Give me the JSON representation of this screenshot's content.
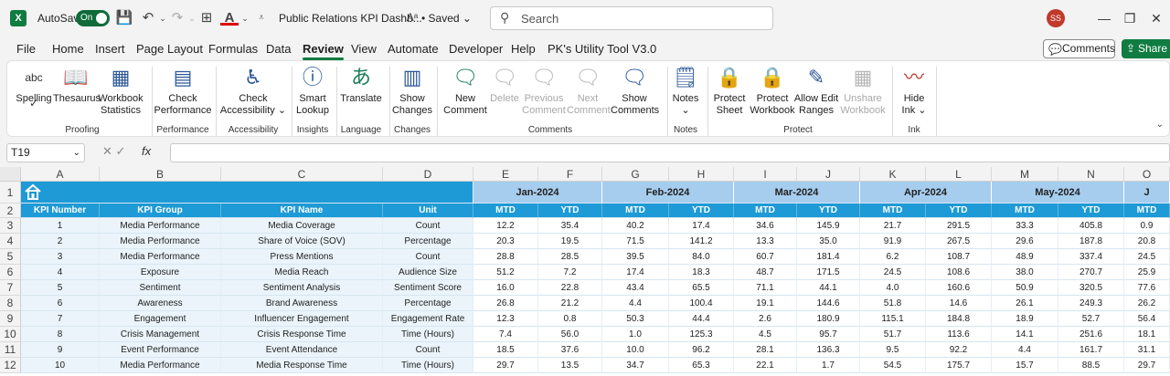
{
  "titlebar": {
    "autosave_label": "AutoSave",
    "autosave_state": "On",
    "doc_title": "Public Relations KPI Dashb...",
    "saved": "Saved",
    "search_placeholder": "Search",
    "avatar_initials": "SS"
  },
  "tabs": [
    "File",
    "Home",
    "Insert",
    "Page Layout",
    "Formulas",
    "Data",
    "Review",
    "View",
    "Automate",
    "Developer",
    "Help",
    "PK's Utility Tool V3.0"
  ],
  "active_tab": "Review",
  "comments_button": "Comments",
  "share_button": "Share",
  "ribbon": {
    "buttons": [
      {
        "label": "Spelling",
        "icon": "spelling-icon",
        "disabled": false
      },
      {
        "label": "Thesaurus",
        "icon": "thesaurus-icon",
        "disabled": false
      },
      {
        "label": "Workbook Statistics",
        "line1": "Workbook",
        "line2": "Statistics",
        "icon": "workbook-statistics-icon",
        "disabled": false
      },
      {
        "label": "Check Performance",
        "line1": "Check",
        "line2": "Performance",
        "icon": "check-performance-icon",
        "disabled": false
      },
      {
        "label": "Check Accessibility",
        "line1": "Check",
        "line2": "Accessibility ⌄",
        "icon": "accessibility-icon",
        "disabled": false
      },
      {
        "label": "Smart Lookup",
        "line1": "Smart",
        "line2": "Lookup",
        "icon": "smart-lookup-icon",
        "disabled": false
      },
      {
        "label": "Translate",
        "icon": "translate-icon",
        "disabled": false
      },
      {
        "label": "Show Changes",
        "line1": "Show",
        "line2": "Changes",
        "icon": "show-changes-icon",
        "disabled": false
      },
      {
        "label": "New Comment",
        "line1": "New",
        "line2": "Comment",
        "icon": "new-comment-icon",
        "disabled": false
      },
      {
        "label": "Delete",
        "icon": "delete-comment-icon",
        "disabled": true
      },
      {
        "label": "Previous Comment",
        "line1": "Previous",
        "line2": "Comment",
        "icon": "previous-comment-icon",
        "disabled": true
      },
      {
        "label": "Next Comment",
        "line1": "Next",
        "line2": "Comment",
        "icon": "next-comment-icon",
        "disabled": true
      },
      {
        "label": "Show Comments",
        "line1": "Show",
        "line2": "Comments",
        "icon": "show-comments-icon",
        "disabled": false
      },
      {
        "label": "Notes",
        "line1": "Notes",
        "line2": "⌄",
        "icon": "notes-icon",
        "disabled": false
      },
      {
        "label": "Protect Sheet",
        "line1": "Protect",
        "line2": "Sheet",
        "icon": "protect-sheet-icon",
        "disabled": false
      },
      {
        "label": "Protect Workbook",
        "line1": "Protect",
        "line2": "Workbook",
        "icon": "protect-workbook-icon",
        "disabled": false
      },
      {
        "label": "Allow Edit Ranges",
        "line1": "Allow Edit",
        "line2": "Ranges",
        "icon": "allow-edit-ranges-icon",
        "disabled": false
      },
      {
        "label": "Unshare Workbook",
        "line1": "Unshare",
        "line2": "Workbook",
        "icon": "unshare-workbook-icon",
        "disabled": true
      },
      {
        "label": "Hide Ink",
        "line1": "Hide",
        "line2": "Ink ⌄",
        "icon": "hide-ink-icon",
        "disabled": false
      }
    ],
    "groups": [
      "Proofing",
      "Performance",
      "Accessibility",
      "Insights",
      "Language",
      "Changes",
      "Comments",
      "Notes",
      "Protect",
      "Ink"
    ]
  },
  "formula_bar": {
    "name_box": "T19",
    "fx": "fx",
    "formula": ""
  },
  "sheet": {
    "column_letters": [
      "A",
      "B",
      "C",
      "D",
      "E",
      "F",
      "G",
      "H",
      "I",
      "J",
      "K",
      "L",
      "M",
      "N",
      "O"
    ],
    "row_numbers": [
      "1",
      "2",
      "3",
      "4",
      "5",
      "6",
      "7",
      "8",
      "9",
      "10",
      "11",
      "12"
    ],
    "months": [
      "Jan-2024",
      "Feb-2024",
      "Mar-2024",
      "Apr-2024",
      "May-2024",
      "J"
    ],
    "headers": [
      "KPI Number",
      "KPI Group",
      "KPI Name",
      "Unit"
    ],
    "sub_headers": [
      "MTD",
      "YTD",
      "MTD",
      "YTD",
      "MTD",
      "YTD",
      "MTD",
      "YTD",
      "MTD",
      "YTD",
      "MTD"
    ],
    "rows": [
      [
        "1",
        "Media Performance",
        "Media Coverage",
        "Count",
        "12.2",
        "35.4",
        "40.2",
        "17.4",
        "34.6",
        "145.9",
        "21.7",
        "291.5",
        "33.3",
        "405.8",
        "0.9"
      ],
      [
        "2",
        "Media Performance",
        "Share of Voice (SOV)",
        "Percentage",
        "20.3",
        "19.5",
        "71.5",
        "141.2",
        "13.3",
        "35.0",
        "91.9",
        "267.5",
        "29.6",
        "187.8",
        "20.8"
      ],
      [
        "3",
        "Media Performance",
        "Press Mentions",
        "Count",
        "28.8",
        "28.5",
        "39.5",
        "84.0",
        "60.7",
        "181.4",
        "6.2",
        "108.7",
        "48.9",
        "337.4",
        "24.5"
      ],
      [
        "4",
        "Exposure",
        "Media Reach",
        "Audience Size",
        "51.2",
        "7.2",
        "17.4",
        "18.3",
        "48.7",
        "171.5",
        "24.5",
        "108.6",
        "38.0",
        "270.7",
        "25.9"
      ],
      [
        "5",
        "Sentiment",
        "Sentiment Analysis",
        "Sentiment Score",
        "16.0",
        "22.8",
        "43.4",
        "65.5",
        "71.1",
        "44.1",
        "4.0",
        "160.6",
        "50.9",
        "320.5",
        "77.6"
      ],
      [
        "6",
        "Awareness",
        "Brand Awareness",
        "Percentage",
        "26.8",
        "21.2",
        "4.4",
        "100.4",
        "19.1",
        "144.6",
        "51.8",
        "14.6",
        "26.1",
        "249.3",
        "26.2"
      ],
      [
        "7",
        "Engagement",
        "Influencer Engagement",
        "Engagement Rate",
        "12.3",
        "0.8",
        "50.3",
        "44.4",
        "2.6",
        "180.9",
        "115.1",
        "184.8",
        "18.9",
        "52.7",
        "56.4"
      ],
      [
        "8",
        "Crisis Management",
        "Crisis Response Time",
        "Time (Hours)",
        "7.4",
        "56.0",
        "1.0",
        "125.3",
        "4.5",
        "95.7",
        "51.7",
        "113.6",
        "14.1",
        "251.6",
        "18.1"
      ],
      [
        "9",
        "Event Performance",
        "Event Attendance",
        "Count",
        "18.5",
        "37.6",
        "10.0",
        "96.2",
        "28.1",
        "136.3",
        "9.5",
        "92.2",
        "4.4",
        "161.7",
        "31.1"
      ],
      [
        "10",
        "Media Performance",
        "Media Response Time",
        "Time (Hours)",
        "29.7",
        "13.5",
        "34.7",
        "65.3",
        "22.1",
        "1.7",
        "54.5",
        "175.7",
        "15.7",
        "88.5",
        "29.7"
      ]
    ]
  },
  "colors": {
    "accent_green": "#107c41",
    "header_blue": "#1e9ad6",
    "month_blue": "#a6cdee"
  }
}
